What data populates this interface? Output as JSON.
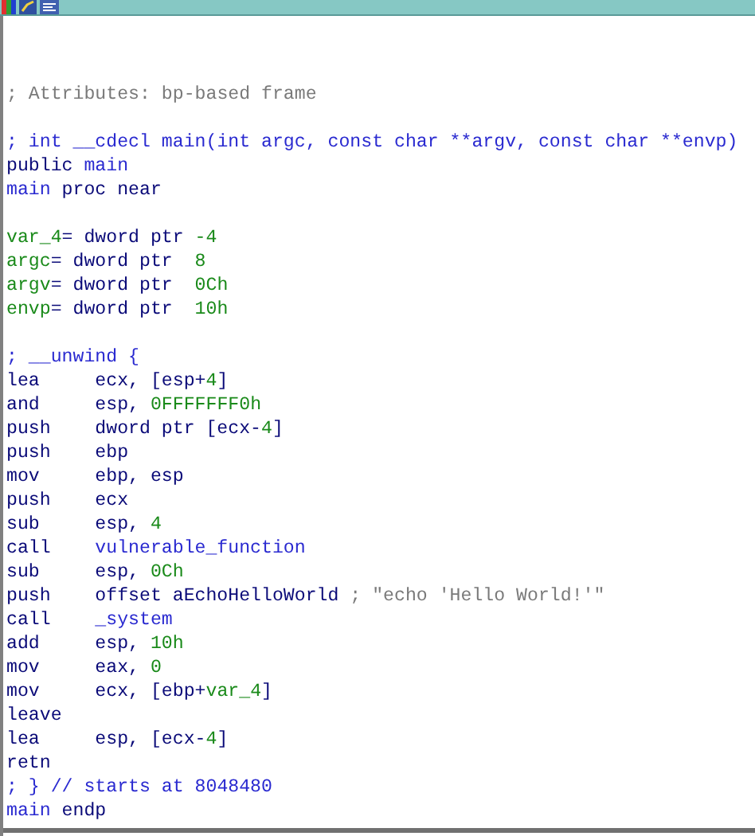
{
  "toolbar": {
    "icons": [
      {
        "kind": "palette"
      },
      {
        "kind": "graph"
      },
      {
        "kind": "text"
      }
    ]
  },
  "lines": [
    {
      "kind": "blank"
    },
    {
      "kind": "code",
      "segments": [
        {
          "kind": "comment",
          "text": "; Attributes: bp-based frame"
        }
      ]
    },
    {
      "kind": "blank"
    },
    {
      "kind": "code",
      "segments": [
        {
          "kind": "name",
          "text": "; int __cdecl main(int argc, const char **argv, const char **envp)"
        }
      ]
    },
    {
      "kind": "code",
      "segments": [
        {
          "kind": "plain",
          "text": "public "
        },
        {
          "kind": "name",
          "text": "main"
        }
      ]
    },
    {
      "kind": "code",
      "segments": [
        {
          "kind": "name",
          "text": "main"
        },
        {
          "kind": "plain",
          "text": " proc near"
        }
      ]
    },
    {
      "kind": "blank"
    },
    {
      "kind": "code",
      "segments": [
        {
          "kind": "var",
          "text": "var_4"
        },
        {
          "kind": "plain",
          "text": "= dword ptr "
        },
        {
          "kind": "number",
          "text": "-4"
        }
      ]
    },
    {
      "kind": "code",
      "segments": [
        {
          "kind": "var",
          "text": "argc"
        },
        {
          "kind": "plain",
          "text": "= dword ptr  "
        },
        {
          "kind": "number",
          "text": "8"
        }
      ]
    },
    {
      "kind": "code",
      "segments": [
        {
          "kind": "var",
          "text": "argv"
        },
        {
          "kind": "plain",
          "text": "= dword ptr  "
        },
        {
          "kind": "number",
          "text": "0Ch"
        }
      ]
    },
    {
      "kind": "code",
      "segments": [
        {
          "kind": "var",
          "text": "envp"
        },
        {
          "kind": "plain",
          "text": "= dword ptr  "
        },
        {
          "kind": "number",
          "text": "10h"
        }
      ]
    },
    {
      "kind": "blank"
    },
    {
      "kind": "code",
      "segments": [
        {
          "kind": "name",
          "text": "; __unwind {"
        }
      ]
    },
    {
      "kind": "instr",
      "mnemonic": "lea",
      "segments": [
        {
          "kind": "plain",
          "text": "ecx, [esp+"
        },
        {
          "kind": "number",
          "text": "4"
        },
        {
          "kind": "plain",
          "text": "]"
        }
      ]
    },
    {
      "kind": "instr",
      "mnemonic": "and",
      "segments": [
        {
          "kind": "plain",
          "text": "esp, "
        },
        {
          "kind": "number",
          "text": "0FFFFFFF0h"
        }
      ]
    },
    {
      "kind": "instr",
      "mnemonic": "push",
      "segments": [
        {
          "kind": "plain",
          "text": "dword ptr [ecx-"
        },
        {
          "kind": "number",
          "text": "4"
        },
        {
          "kind": "plain",
          "text": "]"
        }
      ]
    },
    {
      "kind": "instr",
      "mnemonic": "push",
      "segments": [
        {
          "kind": "plain",
          "text": "ebp"
        }
      ]
    },
    {
      "kind": "instr",
      "mnemonic": "mov",
      "segments": [
        {
          "kind": "plain",
          "text": "ebp, esp"
        }
      ]
    },
    {
      "kind": "instr",
      "mnemonic": "push",
      "segments": [
        {
          "kind": "plain",
          "text": "ecx"
        }
      ]
    },
    {
      "kind": "instr",
      "mnemonic": "sub",
      "segments": [
        {
          "kind": "plain",
          "text": "esp, "
        },
        {
          "kind": "number",
          "text": "4"
        }
      ]
    },
    {
      "kind": "instr",
      "mnemonic": "call",
      "segments": [
        {
          "kind": "name",
          "text": "vulnerable_function"
        }
      ]
    },
    {
      "kind": "instr",
      "mnemonic": "sub",
      "segments": [
        {
          "kind": "plain",
          "text": "esp, "
        },
        {
          "kind": "number",
          "text": "0Ch"
        }
      ]
    },
    {
      "kind": "instr",
      "mnemonic": "push",
      "segments": [
        {
          "kind": "plain",
          "text": "offset aEchoHelloWorld"
        },
        {
          "kind": "comment",
          "text": " ; \"echo 'Hello World!'\""
        }
      ]
    },
    {
      "kind": "instr",
      "mnemonic": "call",
      "segments": [
        {
          "kind": "name",
          "text": "_system"
        }
      ]
    },
    {
      "kind": "instr",
      "mnemonic": "add",
      "segments": [
        {
          "kind": "plain",
          "text": "esp, "
        },
        {
          "kind": "number",
          "text": "10h"
        }
      ]
    },
    {
      "kind": "instr",
      "mnemonic": "mov",
      "segments": [
        {
          "kind": "plain",
          "text": "eax, "
        },
        {
          "kind": "number",
          "text": "0"
        }
      ]
    },
    {
      "kind": "instr",
      "mnemonic": "mov",
      "segments": [
        {
          "kind": "plain",
          "text": "ecx, [ebp+"
        },
        {
          "kind": "var",
          "text": "var_4"
        },
        {
          "kind": "plain",
          "text": "]"
        }
      ]
    },
    {
      "kind": "instr",
      "mnemonic": "leave"
    },
    {
      "kind": "instr",
      "mnemonic": "lea",
      "segments": [
        {
          "kind": "plain",
          "text": "esp, [ecx-"
        },
        {
          "kind": "number",
          "text": "4"
        },
        {
          "kind": "plain",
          "text": "]"
        }
      ]
    },
    {
      "kind": "instr",
      "mnemonic": "retn"
    },
    {
      "kind": "code",
      "segments": [
        {
          "kind": "name",
          "text": "; } // starts at 8048480"
        }
      ]
    },
    {
      "kind": "code",
      "segments": [
        {
          "kind": "name",
          "text": "main"
        },
        {
          "kind": "plain",
          "text": " endp"
        }
      ]
    }
  ]
}
